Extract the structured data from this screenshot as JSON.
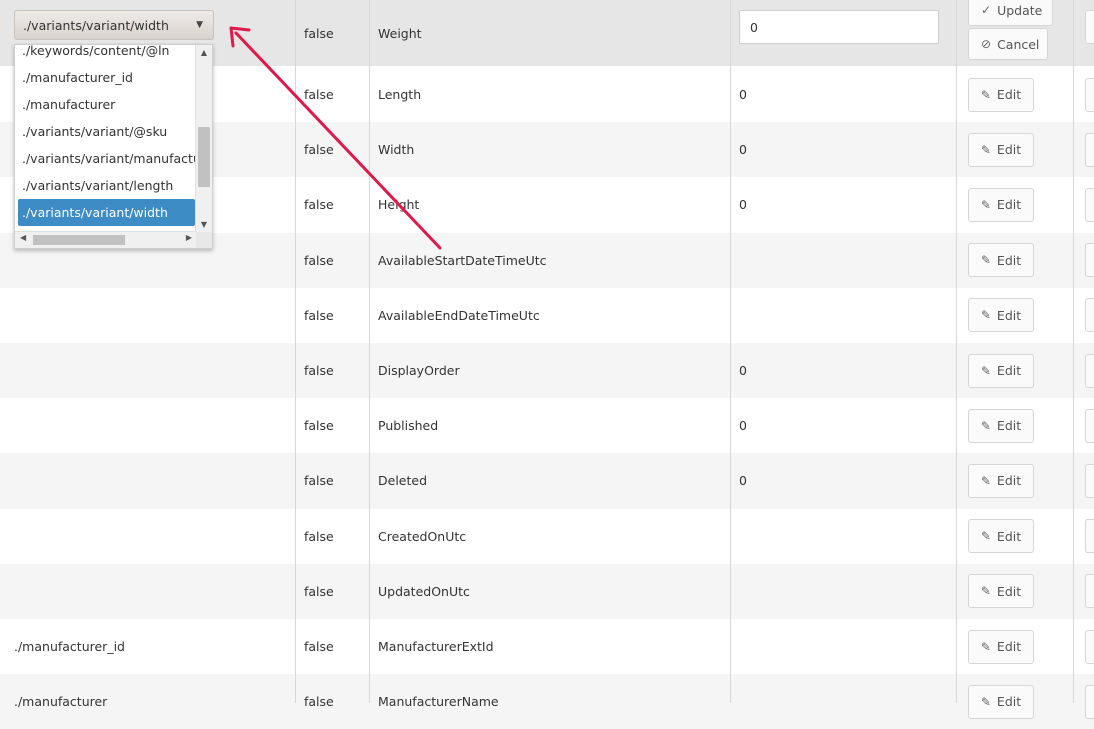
{
  "editing_row": {
    "selected_source": "./variants/variant/width",
    "required": "false",
    "field": "Weight",
    "default_value": "0",
    "update_label": "Update",
    "cancel_label": "Cancel"
  },
  "dropdown": {
    "options": [
      "./keywords/content/@ln",
      "./manufacturer_id",
      "./manufacturer",
      "./variants/variant/@sku",
      "./variants/variant/manufacturer",
      "./variants/variant/length",
      "./variants/variant/width"
    ],
    "selected": "./variants/variant/width"
  },
  "rows": [
    {
      "source": "",
      "required": "false",
      "field": "Length",
      "default": "0",
      "action": "Edit"
    },
    {
      "source": "",
      "required": "false",
      "field": "Width",
      "default": "0",
      "action": "Edit"
    },
    {
      "source": "",
      "required": "false",
      "field": "Height",
      "default": "0",
      "action": "Edit"
    },
    {
      "source": "",
      "required": "false",
      "field": "AvailableStartDateTimeUtc",
      "default": "",
      "action": "Edit"
    },
    {
      "source": "",
      "required": "false",
      "field": "AvailableEndDateTimeUtc",
      "default": "",
      "action": "Edit"
    },
    {
      "source": "",
      "required": "false",
      "field": "DisplayOrder",
      "default": "0",
      "action": "Edit"
    },
    {
      "source": "",
      "required": "false",
      "field": "Published",
      "default": "0",
      "action": "Edit"
    },
    {
      "source": "",
      "required": "false",
      "field": "Deleted",
      "default": "0",
      "action": "Edit"
    },
    {
      "source": "",
      "required": "false",
      "field": "CreatedOnUtc",
      "default": "",
      "action": "Edit"
    },
    {
      "source": "",
      "required": "false",
      "field": "UpdatedOnUtc",
      "default": "",
      "action": "Edit"
    },
    {
      "source": "./manufacturer_id",
      "required": "false",
      "field": "ManufacturerExtId",
      "default": "",
      "action": "Edit"
    },
    {
      "source": "./manufacturer",
      "required": "false",
      "field": "ManufacturerName",
      "default": "",
      "action": "Edit"
    }
  ],
  "colors": {
    "row_alt": "#f5f5f5",
    "row_editing": "#e6e6e6",
    "selected_option": "#3d8cc6",
    "annotation_arrow": "#e0194a"
  },
  "icons": {
    "edit": "pencil-icon",
    "update": "check-icon",
    "cancel": "ban-icon",
    "select_caret": "caret-down-icon"
  }
}
